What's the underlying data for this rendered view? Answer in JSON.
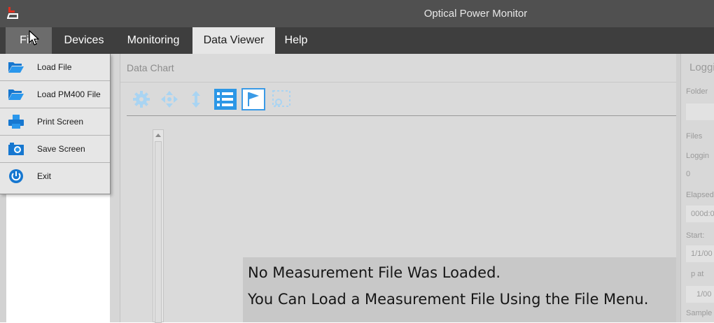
{
  "window": {
    "title": "Optical Power Monitor"
  },
  "menu": {
    "file": "File",
    "devices": "Devices",
    "monitoring": "Monitoring",
    "data_viewer": "Data Viewer",
    "help": "Help"
  },
  "file_menu": {
    "items": [
      {
        "label": "Load File",
        "icon": "folder-open-icon"
      },
      {
        "label": "Load PM400 File",
        "icon": "folder-open-icon"
      },
      {
        "label": "Print Screen",
        "icon": "printer-icon"
      },
      {
        "label": "Save Screen",
        "icon": "camera-icon"
      },
      {
        "label": "Exit",
        "icon": "power-icon"
      }
    ]
  },
  "chart_panel": {
    "title": "Data Chart",
    "toolbar": [
      "settings-gear-icon",
      "pan-move-icon",
      "vertical-scale-icon",
      "list-view-icon",
      "flag-marker-icon",
      "zoom-selection-icon"
    ]
  },
  "notice": {
    "line1": "No Measurement File Was Loaded.",
    "line2": "You Can Load a Measurement File Using the File Menu."
  },
  "logging_panel": {
    "title": "Loggi",
    "folder_label": "Folder",
    "files_label": "Files",
    "logging_label": "Loggin",
    "logging_value": "0",
    "elapsed_label": "Elapsed",
    "elapsed_value": "000d:0",
    "start_label": "Start:",
    "start_value": "1/1/00",
    "stop_label": "p at",
    "stop_value": "1/00",
    "sample_label": "Sample"
  },
  "colors": {
    "titlebar": "#505050",
    "menubar": "#3e3e3e",
    "active_tab": "#e6e6e6",
    "icon_blue": "#1e8ee0",
    "toolbar_icon": "#9fd1f5"
  }
}
